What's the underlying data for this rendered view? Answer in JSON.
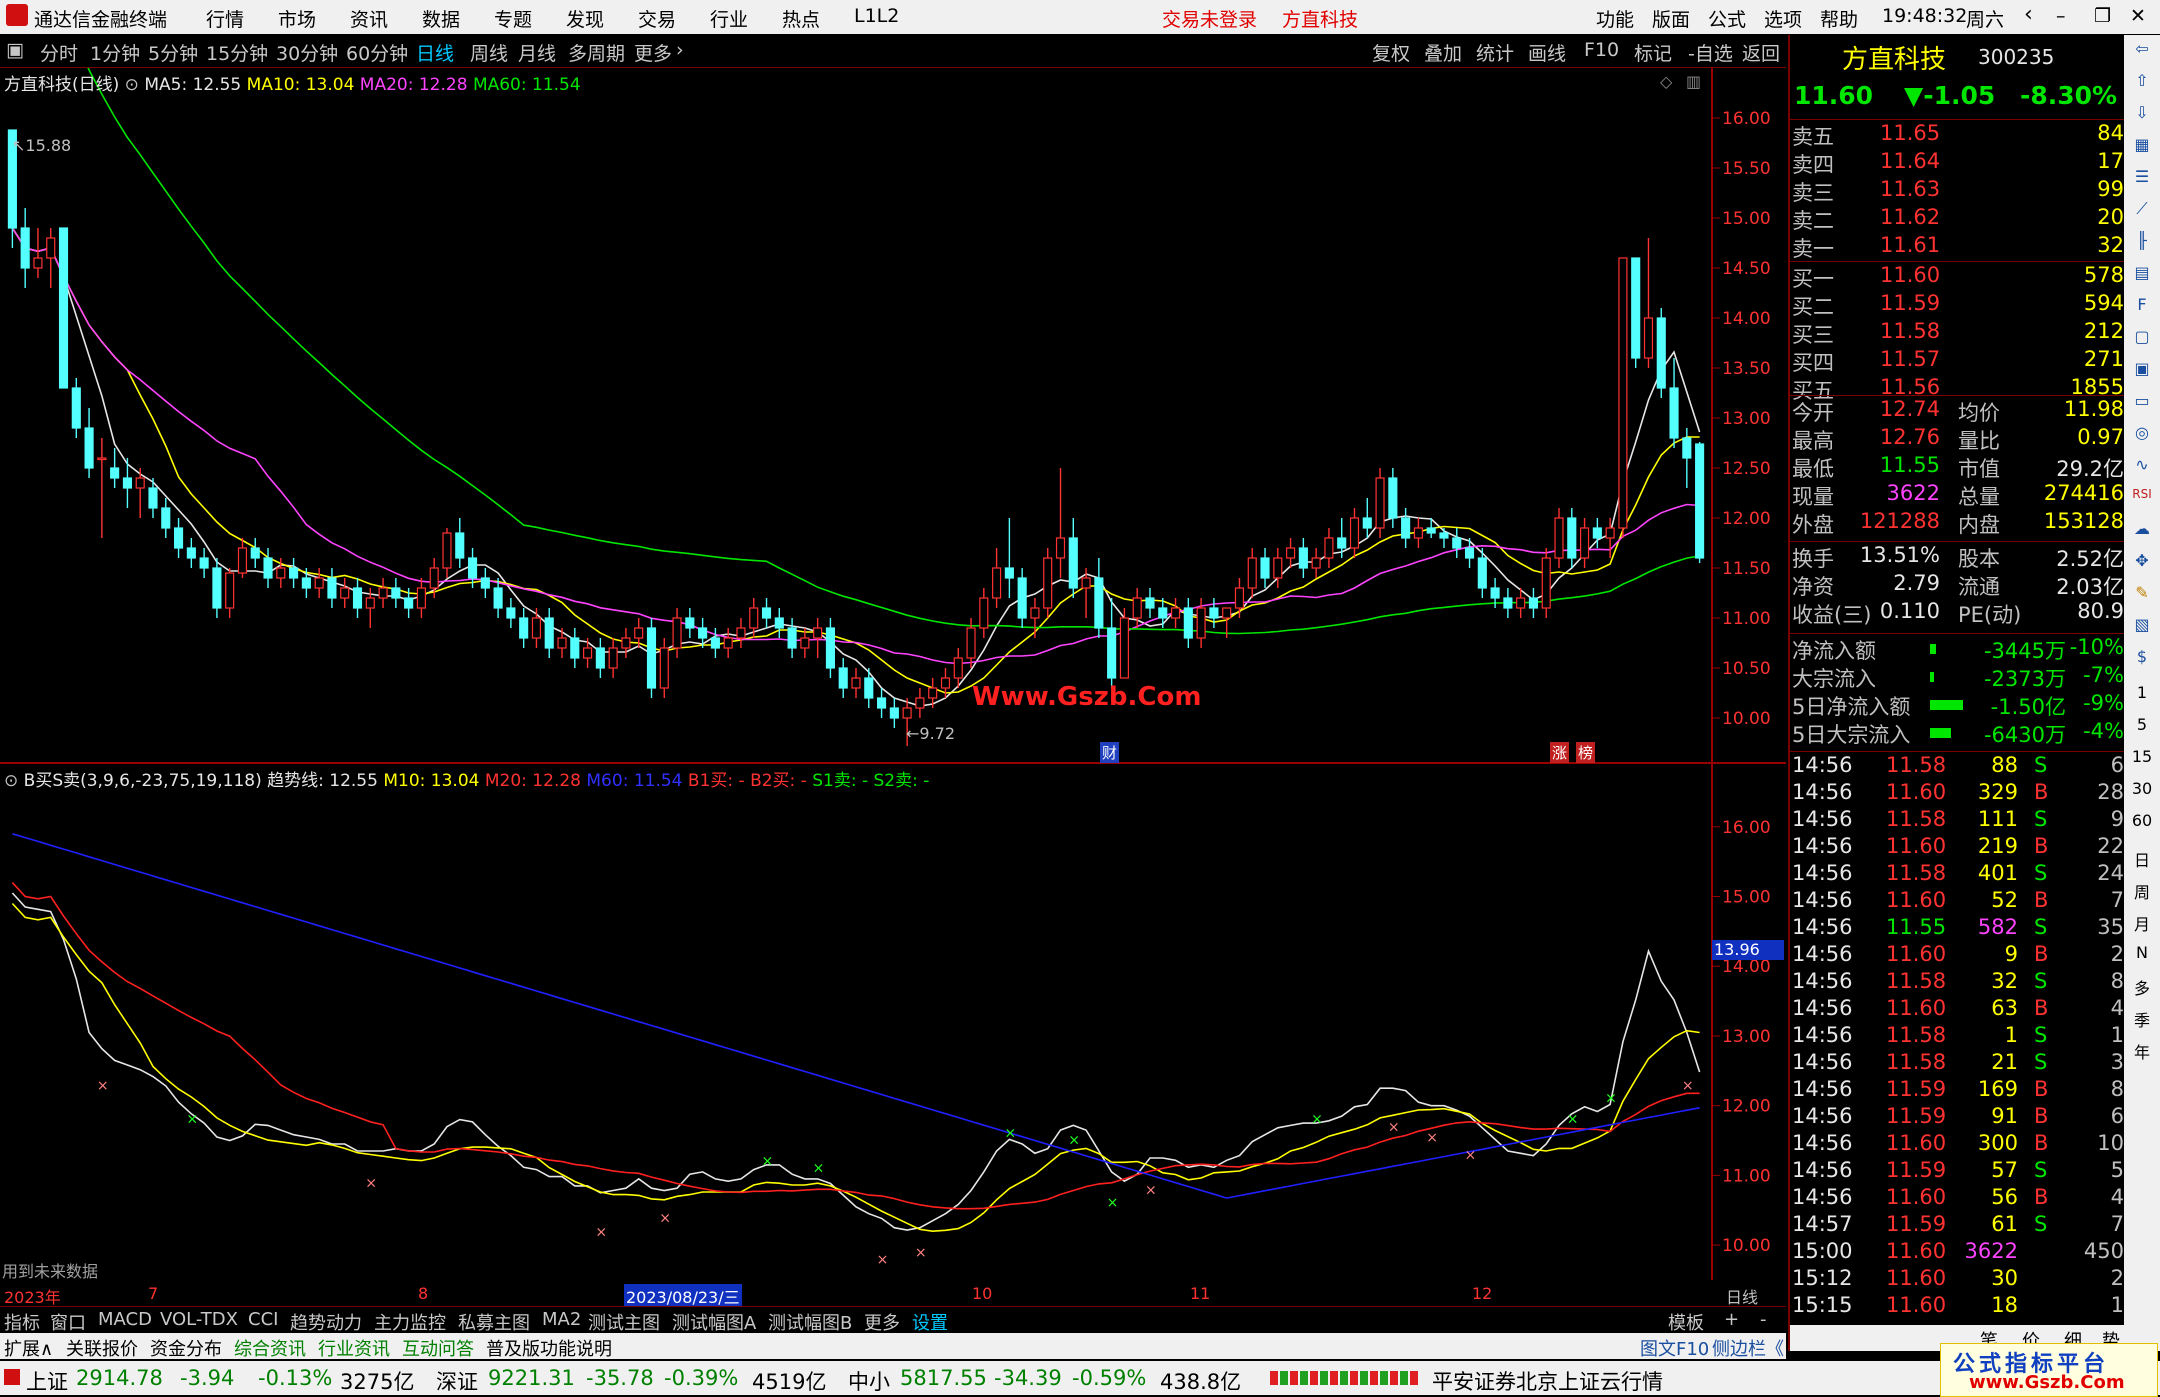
{
  "app": {
    "title": "通达信金融终端",
    "menu": [
      "行情",
      "市场",
      "资讯",
      "数据",
      "专题",
      "发现",
      "交易",
      "行业",
      "热点",
      "L1L2"
    ],
    "trade_status": "交易未登录",
    "stock_title": "方直科技",
    "right_menu": [
      "功能",
      "版面",
      "公式",
      "选项",
      "帮助"
    ],
    "clock": "19:48:32",
    "weekday": "周六"
  },
  "tabs": {
    "periods": [
      "分时",
      "1分钟",
      "5分钟",
      "15分钟",
      "30分钟",
      "60分钟",
      "日线",
      "周线",
      "月线",
      "多周期",
      "更多"
    ],
    "active": "日线",
    "tools": [
      "复权",
      "叠加",
      "统计",
      "画线",
      "F10",
      "标记",
      "-自选",
      "返回"
    ]
  },
  "main_chart": {
    "legend_name": "方直科技(日线)",
    "ma5": "MA5: 12.55",
    "ma10": "MA10: 13.04",
    "ma20": "MA20: 12.28",
    "ma60": "MA60: 11.54",
    "high_label": "15.88",
    "low_label": "9.72",
    "marker_cai": "财",
    "marker_zhang": "涨",
    "marker_bang": "榜",
    "watermark": "Www.Gszb.Com",
    "yticks": [
      "16.00",
      "15.50",
      "15.00",
      "14.50",
      "14.00",
      "13.50",
      "13.00",
      "12.50",
      "12.00",
      "11.50",
      "11.00",
      "10.50",
      "10.00"
    ]
  },
  "sub_chart": {
    "legend_name": "B买S卖(3,9,6,-23,75,19,118)",
    "trend": "趋势线: 12.55",
    "m10": "M10: 13.04",
    "m20": "M20: 12.28",
    "m60": "M60: 11.54",
    "b1": "B1买: -",
    "b2": "B2买: -",
    "s1": "S1卖: -",
    "s2": "S2卖: -",
    "future_note": "用到未来数据",
    "yticks": [
      "16.00",
      "15.00",
      "14.00",
      "13.00",
      "12.00",
      "11.00",
      "10.00"
    ],
    "current_tag": "13.96"
  },
  "xaxis": {
    "labels": [
      "2023年",
      "7",
      "8",
      "2023/08/23/三",
      "10",
      "11",
      "12"
    ],
    "period_label": "日线"
  },
  "chart_data": {
    "type": "candlestick",
    "title": "方直科技(日线)",
    "ylim": [
      9.6,
      16.3
    ],
    "ohlc": [
      [
        15.88,
        15.88,
        14.7,
        14.9
      ],
      [
        14.9,
        15.1,
        14.3,
        14.5
      ],
      [
        14.5,
        14.9,
        14.4,
        14.6
      ],
      [
        14.6,
        14.9,
        14.3,
        14.8
      ],
      [
        14.9,
        14.9,
        13.3,
        13.3
      ],
      [
        13.3,
        13.4,
        12.8,
        12.9
      ],
      [
        12.9,
        13.1,
        12.4,
        12.5
      ],
      [
        12.6,
        12.8,
        11.8,
        12.6
      ],
      [
        12.5,
        12.7,
        12.3,
        12.4
      ],
      [
        12.4,
        12.6,
        12.1,
        12.3
      ],
      [
        12.3,
        12.5,
        12.0,
        12.4
      ],
      [
        12.3,
        12.4,
        12.0,
        12.1
      ],
      [
        12.1,
        12.2,
        11.8,
        11.9
      ],
      [
        11.9,
        12.0,
        11.6,
        11.7
      ],
      [
        11.7,
        11.8,
        11.5,
        11.6
      ],
      [
        11.6,
        11.7,
        11.4,
        11.5
      ],
      [
        11.5,
        11.6,
        11.0,
        11.1
      ],
      [
        11.1,
        11.5,
        11.0,
        11.45
      ],
      [
        11.45,
        11.8,
        11.4,
        11.7
      ],
      [
        11.7,
        11.8,
        11.5,
        11.6
      ],
      [
        11.6,
        11.7,
        11.3,
        11.4
      ],
      [
        11.4,
        11.6,
        11.3,
        11.5
      ],
      [
        11.5,
        11.6,
        11.3,
        11.4
      ],
      [
        11.4,
        11.5,
        11.2,
        11.3
      ],
      [
        11.3,
        11.5,
        11.2,
        11.4
      ],
      [
        11.4,
        11.5,
        11.1,
        11.2
      ],
      [
        11.2,
        11.4,
        11.1,
        11.3
      ],
      [
        11.3,
        11.4,
        11.0,
        11.1
      ],
      [
        11.1,
        11.3,
        10.9,
        11.2
      ],
      [
        11.2,
        11.4,
        11.1,
        11.3
      ],
      [
        11.3,
        11.4,
        11.1,
        11.2
      ],
      [
        11.2,
        11.3,
        11.0,
        11.1
      ],
      [
        11.1,
        11.4,
        11.0,
        11.3
      ],
      [
        11.3,
        11.6,
        11.2,
        11.5
      ],
      [
        11.5,
        11.9,
        11.4,
        11.85
      ],
      [
        11.85,
        12.0,
        11.5,
        11.6
      ],
      [
        11.6,
        11.7,
        11.3,
        11.4
      ],
      [
        11.4,
        11.5,
        11.2,
        11.3
      ],
      [
        11.3,
        11.4,
        11.0,
        11.1
      ],
      [
        11.1,
        11.2,
        10.9,
        11.0
      ],
      [
        11.0,
        11.1,
        10.7,
        10.8
      ],
      [
        10.8,
        11.1,
        10.7,
        11.0
      ],
      [
        11.0,
        11.1,
        10.6,
        10.7
      ],
      [
        10.7,
        10.9,
        10.6,
        10.8
      ],
      [
        10.8,
        10.9,
        10.5,
        10.6
      ],
      [
        10.6,
        10.8,
        10.5,
        10.7
      ],
      [
        10.7,
        10.8,
        10.4,
        10.5
      ],
      [
        10.5,
        10.8,
        10.4,
        10.7
      ],
      [
        10.7,
        10.9,
        10.6,
        10.8
      ],
      [
        10.8,
        11.0,
        10.7,
        10.9
      ],
      [
        10.9,
        11.0,
        10.2,
        10.3
      ],
      [
        10.3,
        10.8,
        10.2,
        10.7
      ],
      [
        10.7,
        11.1,
        10.6,
        11.0
      ],
      [
        11.0,
        11.1,
        10.8,
        10.9
      ],
      [
        10.9,
        11.0,
        10.7,
        10.8
      ],
      [
        10.8,
        10.9,
        10.6,
        10.7
      ],
      [
        10.7,
        10.9,
        10.6,
        10.8
      ],
      [
        10.8,
        11.0,
        10.7,
        10.9
      ],
      [
        10.9,
        11.2,
        10.8,
        11.1
      ],
      [
        11.1,
        11.2,
        10.9,
        11.0
      ],
      [
        11.0,
        11.1,
        10.8,
        10.9
      ],
      [
        10.9,
        11.0,
        10.6,
        10.7
      ],
      [
        10.7,
        10.9,
        10.6,
        10.8
      ],
      [
        10.8,
        11.0,
        10.6,
        10.9
      ],
      [
        10.9,
        11.0,
        10.4,
        10.5
      ],
      [
        10.5,
        10.6,
        10.2,
        10.3
      ],
      [
        10.3,
        10.5,
        10.2,
        10.4
      ],
      [
        10.4,
        10.5,
        10.1,
        10.2
      ],
      [
        10.2,
        10.3,
        10.0,
        10.1
      ],
      [
        10.1,
        10.2,
        9.9,
        10.0
      ],
      [
        10.0,
        10.2,
        9.72,
        10.1
      ],
      [
        10.1,
        10.3,
        10.0,
        10.2
      ],
      [
        10.2,
        10.4,
        10.1,
        10.3
      ],
      [
        10.3,
        10.5,
        10.2,
        10.4
      ],
      [
        10.4,
        10.7,
        10.3,
        10.6
      ],
      [
        10.6,
        11.0,
        10.5,
        10.9
      ],
      [
        10.9,
        11.3,
        10.8,
        11.2
      ],
      [
        11.2,
        11.7,
        11.1,
        11.5
      ],
      [
        11.5,
        12.0,
        11.2,
        11.4
      ],
      [
        11.4,
        11.5,
        10.9,
        11.0
      ],
      [
        11.0,
        11.2,
        10.8,
        11.1
      ],
      [
        11.1,
        11.7,
        11.0,
        11.6
      ],
      [
        11.6,
        12.5,
        11.4,
        11.8
      ],
      [
        11.8,
        12.0,
        11.2,
        11.3
      ],
      [
        11.3,
        11.5,
        11.0,
        11.4
      ],
      [
        11.4,
        11.6,
        10.8,
        10.9
      ],
      [
        10.9,
        11.2,
        10.3,
        10.4
      ],
      [
        10.4,
        11.1,
        10.4,
        11.0
      ],
      [
        11.0,
        11.3,
        10.9,
        11.2
      ],
      [
        11.2,
        11.3,
        11.0,
        11.1
      ],
      [
        11.1,
        11.2,
        10.9,
        11.0
      ],
      [
        11.0,
        11.2,
        10.9,
        11.1
      ],
      [
        11.1,
        11.2,
        10.7,
        10.8
      ],
      [
        10.8,
        11.2,
        10.7,
        11.1
      ],
      [
        11.1,
        11.2,
        10.9,
        11.0
      ],
      [
        11.0,
        11.1,
        10.8,
        11.1
      ],
      [
        11.1,
        11.4,
        11.0,
        11.3
      ],
      [
        11.3,
        11.7,
        11.2,
        11.6
      ],
      [
        11.6,
        11.7,
        11.3,
        11.4
      ],
      [
        11.4,
        11.7,
        11.3,
        11.6
      ],
      [
        11.6,
        11.8,
        11.5,
        11.7
      ],
      [
        11.7,
        11.8,
        11.4,
        11.5
      ],
      [
        11.5,
        11.7,
        11.4,
        11.6
      ],
      [
        11.6,
        11.9,
        11.5,
        11.8
      ],
      [
        11.8,
        12.0,
        11.6,
        11.7
      ],
      [
        11.7,
        12.1,
        11.6,
        12.0
      ],
      [
        12.0,
        12.2,
        11.8,
        11.9
      ],
      [
        11.9,
        12.5,
        11.8,
        12.4
      ],
      [
        12.4,
        12.5,
        11.9,
        12.0
      ],
      [
        12.0,
        12.1,
        11.7,
        11.8
      ],
      [
        11.8,
        12.0,
        11.7,
        11.9
      ],
      [
        11.9,
        12.0,
        11.8,
        11.85
      ],
      [
        11.85,
        11.9,
        11.7,
        11.8
      ],
      [
        11.8,
        11.9,
        11.6,
        11.7
      ],
      [
        11.7,
        11.8,
        11.5,
        11.6
      ],
      [
        11.6,
        11.7,
        11.2,
        11.3
      ],
      [
        11.3,
        11.4,
        11.1,
        11.2
      ],
      [
        11.2,
        11.3,
        11.0,
        11.1
      ],
      [
        11.1,
        11.3,
        11.0,
        11.2
      ],
      [
        11.2,
        11.3,
        11.0,
        11.1
      ],
      [
        11.1,
        11.7,
        11.0,
        11.6
      ],
      [
        11.6,
        12.1,
        11.5,
        12.0
      ],
      [
        12.0,
        12.1,
        11.5,
        11.6
      ],
      [
        11.6,
        12.0,
        11.5,
        11.9
      ],
      [
        11.9,
        12.0,
        11.7,
        11.8
      ],
      [
        11.8,
        12.0,
        11.6,
        11.9
      ],
      [
        11.9,
        14.6,
        11.8,
        14.6
      ],
      [
        14.6,
        14.6,
        13.5,
        13.6
      ],
      [
        13.6,
        14.8,
        13.5,
        14.0
      ],
      [
        14.0,
        14.1,
        13.2,
        13.3
      ],
      [
        13.3,
        13.6,
        12.7,
        12.8
      ],
      [
        12.8,
        12.9,
        12.3,
        12.6
      ],
      [
        12.74,
        12.76,
        11.55,
        11.6
      ]
    ],
    "ma_series": [
      {
        "name": "MA5",
        "color": "#e6e6e6"
      },
      {
        "name": "MA10",
        "color": "#ffff00"
      },
      {
        "name": "MA20",
        "color": "#ff44ff"
      },
      {
        "name": "MA60",
        "color": "#00e600"
      }
    ]
  },
  "quote": {
    "name": "方直科技",
    "code": "300235",
    "price": "11.60",
    "change": "▼-1.05",
    "pct": "-8.30%",
    "asks": [
      {
        "label": "卖五",
        "price": "11.65",
        "vol": "84"
      },
      {
        "label": "卖四",
        "price": "11.64",
        "vol": "17"
      },
      {
        "label": "卖三",
        "price": "11.63",
        "vol": "99"
      },
      {
        "label": "卖二",
        "price": "11.62",
        "vol": "20"
      },
      {
        "label": "卖一",
        "price": "11.61",
        "vol": "32"
      }
    ],
    "bids": [
      {
        "label": "买一",
        "price": "11.60",
        "vol": "578"
      },
      {
        "label": "买二",
        "price": "11.59",
        "vol": "594"
      },
      {
        "label": "买三",
        "price": "11.58",
        "vol": "212"
      },
      {
        "label": "买四",
        "price": "11.57",
        "vol": "271"
      },
      {
        "label": "买五",
        "price": "11.56",
        "vol": "1855"
      }
    ],
    "stats": [
      {
        "l1": "今开",
        "v1": "12.74",
        "c1": "red",
        "l2": "均价",
        "v2": "11.98",
        "c2": "yellow"
      },
      {
        "l1": "最高",
        "v1": "12.76",
        "c1": "red",
        "l2": "量比",
        "v2": "0.97",
        "c2": "yellow"
      },
      {
        "l1": "最低",
        "v1": "11.55",
        "c1": "green",
        "l2": "市值",
        "v2": "29.2亿",
        "c2": "white"
      },
      {
        "l1": "现量",
        "v1": "3622",
        "c1": "magenta",
        "l2": "总量",
        "v2": "274416",
        "c2": "yellow"
      },
      {
        "l1": "外盘",
        "v1": "121288",
        "c1": "red",
        "l2": "内盘",
        "v2": "153128",
        "c2": "yellow"
      }
    ],
    "stats2": [
      {
        "l1": "换手",
        "v1": "13.51%",
        "l2": "股本",
        "v2": "2.52亿"
      },
      {
        "l1": "净资",
        "v1": "2.79",
        "l2": "流通",
        "v2": "2.03亿"
      },
      {
        "l1": "收益(三)",
        "v1": "0.110",
        "l2": "PE(动)",
        "v2": "80.9"
      }
    ],
    "flows": [
      {
        "label": "净流入额",
        "val": "-3445万",
        "pct": "-10%",
        "bar": 0.1
      },
      {
        "label": "大宗流入",
        "val": "-2373万",
        "pct": "-7%",
        "bar": 0.07
      },
      {
        "label": "5日净流入额",
        "val": "-1.50亿",
        "pct": "-9%",
        "bar": 0.55
      },
      {
        "label": "5日大宗流入",
        "val": "-6430万",
        "pct": "-4%",
        "bar": 0.35
      }
    ],
    "ticks": [
      {
        "t": "14:56",
        "p": "11.58",
        "v": "88",
        "bs": "S",
        "n": "6"
      },
      {
        "t": "14:56",
        "p": "11.60",
        "v": "329",
        "bs": "B",
        "n": "28"
      },
      {
        "t": "14:56",
        "p": "11.58",
        "v": "111",
        "bs": "S",
        "n": "9"
      },
      {
        "t": "14:56",
        "p": "11.60",
        "v": "219",
        "bs": "B",
        "n": "22"
      },
      {
        "t": "14:56",
        "p": "11.58",
        "v": "401",
        "bs": "S",
        "n": "24"
      },
      {
        "t": "14:56",
        "p": "11.60",
        "v": "52",
        "bs": "B",
        "n": "7"
      },
      {
        "t": "14:56",
        "p": "11.55",
        "v": "582",
        "bs": "S",
        "n": "35"
      },
      {
        "t": "14:56",
        "p": "11.60",
        "v": "9",
        "bs": "B",
        "n": "2"
      },
      {
        "t": "14:56",
        "p": "11.58",
        "v": "32",
        "bs": "S",
        "n": "8"
      },
      {
        "t": "14:56",
        "p": "11.60",
        "v": "63",
        "bs": "B",
        "n": "4"
      },
      {
        "t": "14:56",
        "p": "11.58",
        "v": "1",
        "bs": "S",
        "n": "1"
      },
      {
        "t": "14:56",
        "p": "11.58",
        "v": "21",
        "bs": "S",
        "n": "3"
      },
      {
        "t": "14:56",
        "p": "11.59",
        "v": "169",
        "bs": "B",
        "n": "8"
      },
      {
        "t": "14:56",
        "p": "11.59",
        "v": "91",
        "bs": "B",
        "n": "6"
      },
      {
        "t": "14:56",
        "p": "11.60",
        "v": "300",
        "bs": "B",
        "n": "10"
      },
      {
        "t": "14:56",
        "p": "11.59",
        "v": "57",
        "bs": "S",
        "n": "5"
      },
      {
        "t": "14:56",
        "p": "11.60",
        "v": "56",
        "bs": "B",
        "n": "4"
      },
      {
        "t": "14:57",
        "p": "11.59",
        "v": "61",
        "bs": "S",
        "n": "7"
      },
      {
        "t": "15:00",
        "p": "11.60",
        "v": "3622",
        "bs": "",
        "n": "450"
      },
      {
        "t": "15:12",
        "p": "11.60",
        "v": "30",
        "bs": "",
        "n": "2"
      },
      {
        "t": "15:15",
        "p": "11.60",
        "v": "18",
        "bs": "",
        "n": "1"
      }
    ],
    "bottom_tabs": [
      "笔",
      "价",
      "细",
      "势"
    ]
  },
  "side_icons": [
    "日",
    "周",
    "月",
    "N",
    "多",
    "季",
    "年",
    "1",
    "5",
    "15",
    "30",
    "60",
    "RSI",
    "F10"
  ],
  "bottom": {
    "tabs1": [
      "指标",
      "窗口",
      "MACD",
      "VOL-TDX",
      "CCI",
      "趋势动力",
      "主力监控",
      "私募主图",
      "MA2",
      "测试主图",
      "测试幅图A",
      "测试幅图B",
      "更多",
      "设置",
      "模板",
      "+",
      "-"
    ],
    "tabs2": [
      "扩展∧",
      "关联报价",
      "资金分布",
      "综合资讯",
      "行业资讯",
      "互动问答",
      "普及版功能说明"
    ],
    "right_tabs": [
      "图文F10",
      "侧边栏《"
    ]
  },
  "status": {
    "sh_name": "上证",
    "sh_val": "2914.78",
    "sh_chg": "-3.94",
    "sh_pct": "-0.13%",
    "sh_amt": "3275亿",
    "sz_name": "深证",
    "sz_val": "9221.31",
    "sz_chg": "-35.78",
    "sz_pct": "-0.39%",
    "sz_amt": "4519亿",
    "zx_name": "中小",
    "zx_val": "5817.55",
    "zx_chg": "-34.39",
    "zx_pct": "-0.59%",
    "zx_amt": "438.8亿",
    "broker": "平安证券北京上证云行情",
    "site_title": "公式指标平台",
    "site_url": "www.Gszb.Com"
  }
}
